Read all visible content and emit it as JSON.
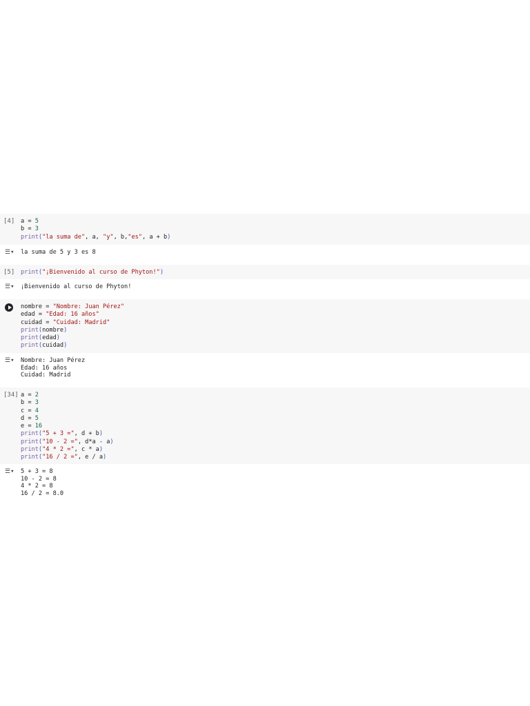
{
  "cells": [
    {
      "label": "[4]",
      "lines": [
        [
          [
            "a = ",
            "v"
          ],
          [
            "5",
            "n"
          ]
        ],
        [
          [
            "b = ",
            "v"
          ],
          [
            "3",
            "n"
          ]
        ],
        [
          [
            "print",
            "k"
          ],
          [
            "(",
            "p"
          ],
          [
            "\"la suma de\"",
            "s"
          ],
          [
            ", a, ",
            "v"
          ],
          [
            "\"y\"",
            "s"
          ],
          [
            ", b,",
            "v"
          ],
          [
            "\"es\"",
            "s"
          ],
          [
            ", a + b",
            "v"
          ],
          [
            ")",
            "p"
          ]
        ]
      ],
      "output": [
        "la suma de 5 y 3 es 8"
      ]
    },
    {
      "label": "[5]",
      "lines": [
        [
          [
            "print",
            "k"
          ],
          [
            "(",
            "p"
          ],
          [
            "\"¡Bienvenido al curso de Phyton!\"",
            "s"
          ],
          [
            ")",
            "p"
          ]
        ]
      ],
      "output": [
        "¡Bienvenido al curso de Phyton!"
      ]
    },
    {
      "label": "",
      "run": true,
      "lines": [
        [
          [
            "nombre = ",
            "v"
          ],
          [
            "\"Nombre: Juan Pérez\"",
            "s"
          ]
        ],
        [
          [
            "edad = ",
            "v"
          ],
          [
            "\"Edad: 16 años\"",
            "s"
          ]
        ],
        [
          [
            "cuidad = ",
            "v"
          ],
          [
            "\"Cuidad: Madrid\"",
            "s"
          ]
        ],
        [
          [
            "print",
            "k"
          ],
          [
            "(",
            "p"
          ],
          [
            "nombre",
            "v"
          ],
          [
            ")",
            "p"
          ]
        ],
        [
          [
            "print",
            "k"
          ],
          [
            "(",
            "p"
          ],
          [
            "edad",
            "v"
          ],
          [
            ")",
            "p"
          ]
        ],
        [
          [
            "print",
            "k"
          ],
          [
            "(",
            "p"
          ],
          [
            "cuidad",
            "v"
          ],
          [
            ")",
            "p"
          ]
        ]
      ],
      "output": [
        "Nombre: Juan Pérez",
        "Edad: 16 años",
        "Cuidad: Madrid"
      ]
    },
    {
      "label": "[34]",
      "lines": [
        [
          [
            "a = ",
            "v"
          ],
          [
            "2",
            "n"
          ]
        ],
        [
          [
            "b = ",
            "v"
          ],
          [
            "3",
            "n"
          ]
        ],
        [
          [
            "c = ",
            "v"
          ],
          [
            "4",
            "n"
          ]
        ],
        [
          [
            "d = ",
            "v"
          ],
          [
            "5",
            "n"
          ]
        ],
        [
          [
            "e = ",
            "v"
          ],
          [
            "16",
            "n"
          ]
        ],
        [
          [
            "print",
            "k"
          ],
          [
            "(",
            "p"
          ],
          [
            "\"5 + 3 =\"",
            "s"
          ],
          [
            ", d + b",
            "v"
          ],
          [
            ")",
            "p"
          ]
        ],
        [
          [
            "print",
            "k"
          ],
          [
            "(",
            "p"
          ],
          [
            "\"10 - 2 =\"",
            "s"
          ],
          [
            ", d*a - a",
            "v"
          ],
          [
            ")",
            "p"
          ]
        ],
        [
          [
            "print",
            "k"
          ],
          [
            "(",
            "p"
          ],
          [
            "\"4 * 2 =\"",
            "s"
          ],
          [
            ", c * a",
            "v"
          ],
          [
            ")",
            "p"
          ]
        ],
        [
          [
            "print",
            "k"
          ],
          [
            "(",
            "p"
          ],
          [
            "\"16 / 2 =\"",
            "s"
          ],
          [
            ", e / a",
            "v"
          ],
          [
            ")",
            "p"
          ]
        ]
      ],
      "output": [
        "5 + 3 = 8",
        "10 - 2 = 8",
        "4 * 2 = 8",
        "16 / 2 = 8.0"
      ]
    }
  ],
  "output_icon": "output-toggle-icon",
  "run_icon": "play-icon"
}
